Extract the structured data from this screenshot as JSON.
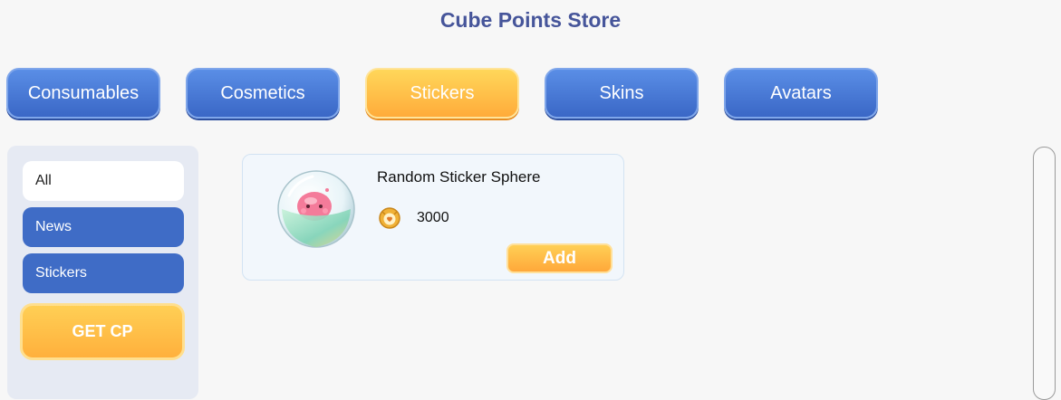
{
  "header": {
    "title": "Cube Points Store"
  },
  "tabs": [
    {
      "label": "Consumables",
      "active": false
    },
    {
      "label": "Cosmetics",
      "active": false
    },
    {
      "label": "Stickers",
      "active": true
    },
    {
      "label": "Skins",
      "active": false
    },
    {
      "label": "Avatars",
      "active": false
    }
  ],
  "sidebar": {
    "items": [
      {
        "label": "All",
        "active": true
      },
      {
        "label": "News",
        "active": false
      },
      {
        "label": "Stickers",
        "active": false
      }
    ],
    "get_cp_label": "GET CP"
  },
  "products": [
    {
      "name": "Random Sticker Sphere",
      "price": "3000",
      "currency_icon": "cube-coin-icon",
      "image_icon": "sticker-sphere-icon",
      "add_label": "Add"
    }
  ],
  "colors": {
    "title": "#46559a",
    "tab_blue": "#3f6cc6",
    "tab_gold": "#ffb83f",
    "sidebar_bg": "#e6eaf3",
    "card_bg": "#f2f7fc"
  }
}
